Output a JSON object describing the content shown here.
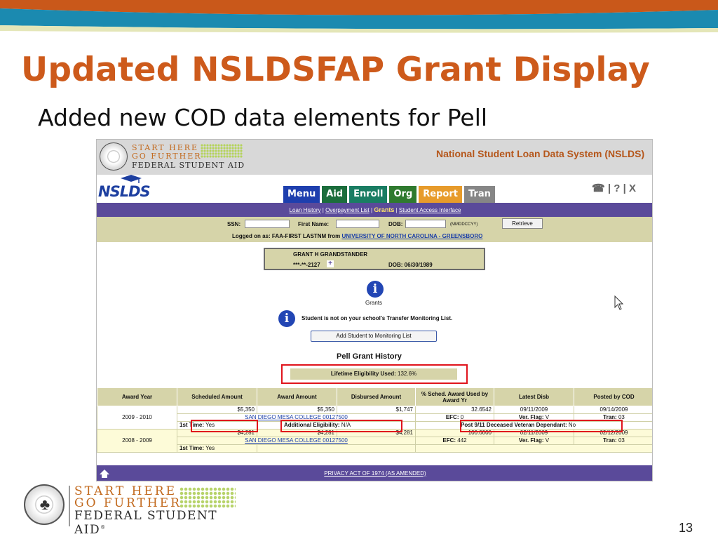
{
  "slide": {
    "title": "Updated NSLDSFAP Grant Display",
    "subtitle": "Added new COD data elements for Pell",
    "number": "13"
  },
  "logo": {
    "line1": "START HERE",
    "line2": "GO FURTHER",
    "line3": "FEDERAL STUDENT AID",
    "registered": "®"
  },
  "colors": {
    "title": "#cd5a1b",
    "nav_purple": "#5a4a9a",
    "tan": "#d6d4a9",
    "highlight_red": "#e0141c",
    "link_blue": "#1a3ea8"
  },
  "app": {
    "header_logo": {
      "line1": "START HERE",
      "line2": "GO FURTHER",
      "line3": "FEDERAL STUDENT AID"
    },
    "system_name": "National Student Loan Data System (NSLDS)",
    "logo_text": "NSLDS",
    "tabs": [
      "Menu",
      "Aid",
      "Enroll",
      "Org",
      "Report",
      "Tran"
    ],
    "tools": {
      "phone_icon": "phone-icon",
      "help_icon": "help-icon",
      "close": "X"
    },
    "subnav": {
      "items": [
        "Loan History",
        "Overpayment List",
        "Grants",
        "Student Access Interface"
      ],
      "current": "Grants",
      "sep": "|"
    },
    "search": {
      "ssn_label": "SSN:",
      "first_name_label": "First Name:",
      "dob_label": "DOB:",
      "dob_hint": "(MMDDCCYY)",
      "retrieve_label": "Retrieve",
      "logged_prefix": "Logged on as: FAA-FIRST LASTNM from",
      "school_link": "UNIVERSITY OF NORTH CAROLINA - GREENSBORO"
    },
    "student": {
      "name": "GRANT H GRANDSTANDER",
      "ssn": "***-**-2127",
      "plus": "+",
      "dob": "DOB: 06/30/1989"
    },
    "grants_caption": "Grants",
    "monitor_message": "Student is not on your school's Transfer Monitoring List.",
    "monitor_button": "Add Student to Monitoring List",
    "history_title": "Pell Grant History",
    "lifetime": {
      "label": "Lifetime Eligibility Used:",
      "value": "132.6%"
    },
    "table": {
      "headers": [
        "Award Year",
        "Scheduled Amount",
        "Award Amount",
        "Disbursed Amount",
        "% Sched. Award Used by Award Yr",
        "Latest Disb",
        "Posted by COD"
      ],
      "groups": [
        {
          "award_year": "2009 - 2010",
          "row1": [
            "$5,350",
            "$5,350",
            "$1,747",
            "32.6542",
            "09/11/2009",
            "09/14/2009"
          ],
          "school": "SAN DIEGO MESA COLLEGE 00127500",
          "efc_label": "EFC:",
          "efc": "0",
          "ver_label": "Ver. Flag:",
          "ver": "V",
          "tran_label": "Tran:",
          "tran": "03",
          "first_time_label": "1st Time:",
          "first_time": "Yes",
          "addl_label": "Additional Eligibility:",
          "addl": "N/A",
          "vet_label": "Post 9/11 Deceased Veteran Dependant:",
          "vet": "No"
        },
        {
          "award_year": "2008 - 2009",
          "row1": [
            "$4,281",
            "$4,281",
            "$4,281",
            "100.0000",
            "02/11/2009",
            "02/12/2009"
          ],
          "school": "SAN DIEGO MESA COLLEGE 00127500",
          "efc_label": "EFC:",
          "efc": "442",
          "ver_label": "Ver. Flag:",
          "ver": "V",
          "tran_label": "Tran:",
          "tran": "03",
          "first_time_label": "1st Time:",
          "first_time": "Yes"
        }
      ]
    },
    "footer_link": "PRIVACY ACT OF 1974 (AS AMENDED)"
  }
}
